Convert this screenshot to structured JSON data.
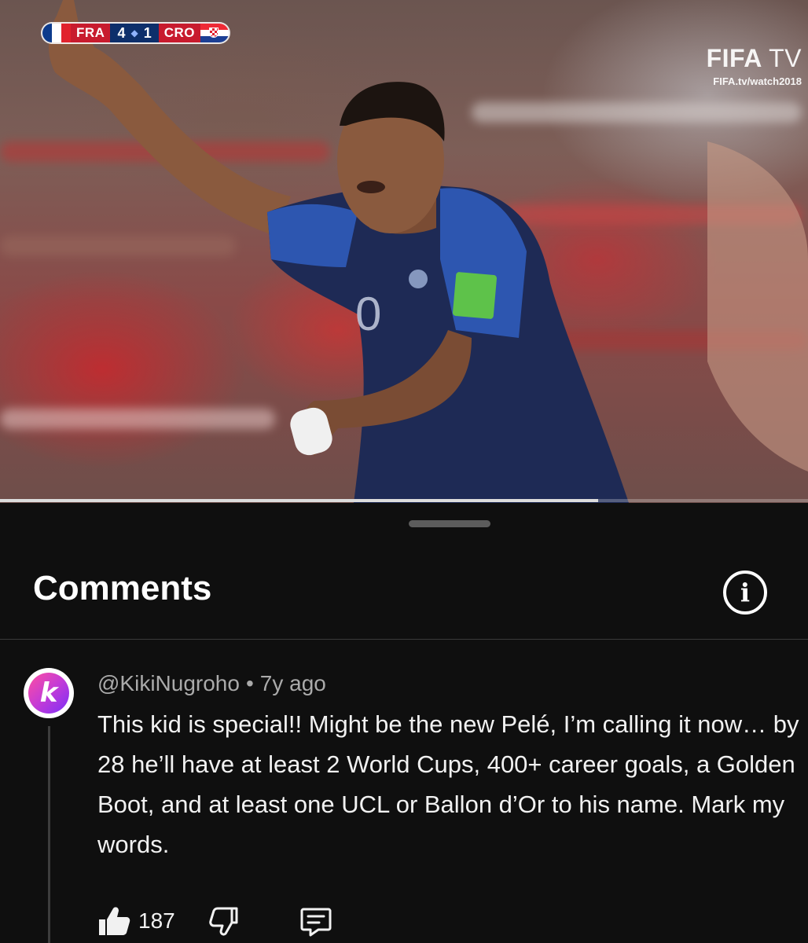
{
  "video": {
    "scorebug": {
      "home_team": "FRA",
      "home_score": "4",
      "away_score": "1",
      "away_team": "CRO"
    },
    "watermark": {
      "logo_fifa": "FIFA",
      "logo_tv": "TV",
      "url": "FIFA.tv/watch2018"
    },
    "progress": 0.74
  },
  "comments": {
    "title": "Comments",
    "info_icon": "info-icon",
    "items": [
      {
        "avatar_letter": "k",
        "author": "@KikiNugroho",
        "separator": "•",
        "time": "7y ago",
        "text": "This kid is special!! Might be the new Pelé, I’m calling it now… by 28 he’ll have at least 2 World Cups, 400+ career goals, a Golden Boot, and at least one UCL or Ballon d’Or to his name. Mark my words.",
        "likes": "187",
        "icons": [
          "thumbs-up-icon",
          "thumbs-down-icon",
          "reply-icon"
        ]
      }
    ]
  },
  "colors": {
    "background": "#0f0f0f",
    "text": "#f1f1f1",
    "meta": "#aaaaaa",
    "divider": "#3a3a3a"
  }
}
